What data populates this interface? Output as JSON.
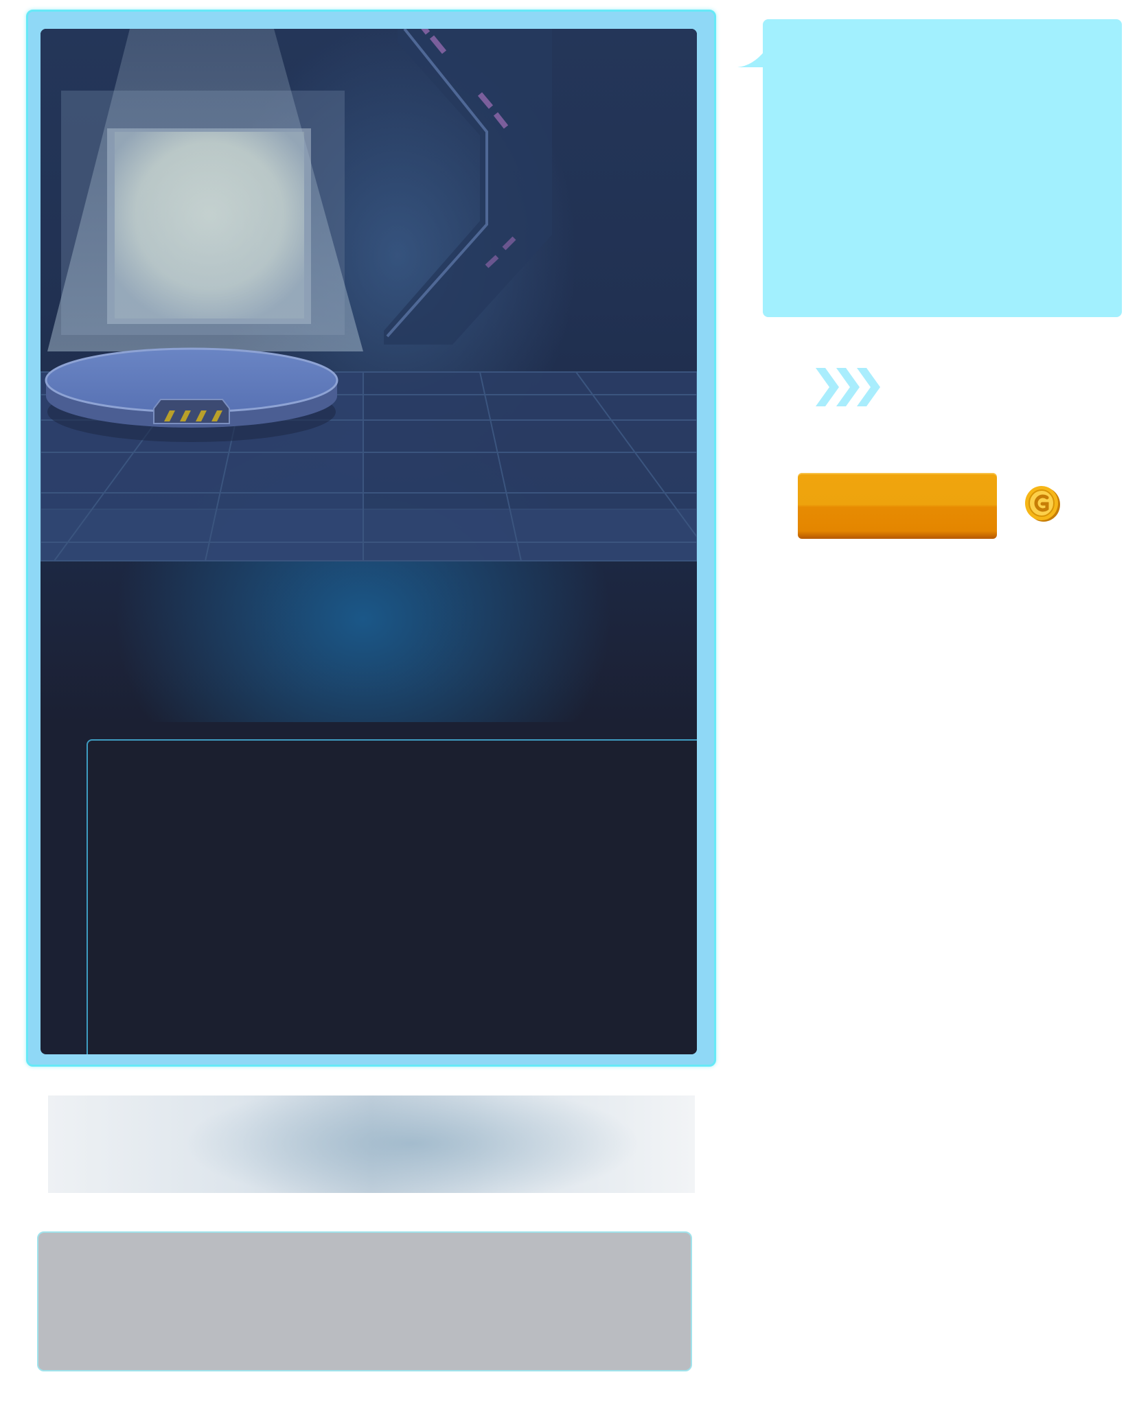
{
  "scene": {
    "info_text": ""
  },
  "bubble": {
    "text": ""
  },
  "purchase": {
    "button_label": "",
    "price": ""
  },
  "icons": {
    "advance": "triple-chevron-right-icon",
    "currency": "gold-coin-icon"
  },
  "colors": {
    "frame_border": "#66e9f7",
    "frame_fill": "#8fd8f6",
    "bubble": "#a2f0fe",
    "button": "#eea30d",
    "coin": "#f6b617",
    "panel": "#1b1f2f",
    "grey_panel": "#babcc1"
  }
}
